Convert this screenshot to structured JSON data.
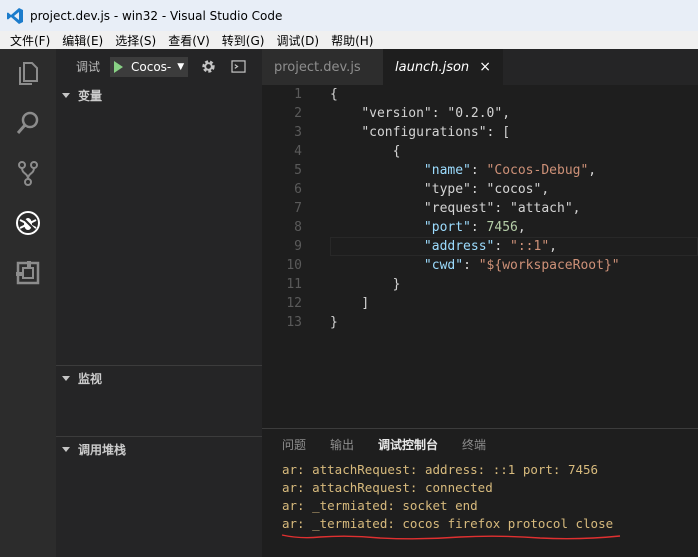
{
  "window": {
    "title": "project.dev.js - win32 - Visual Studio Code"
  },
  "menu": [
    "文件(F)",
    "编辑(E)",
    "选择(S)",
    "查看(V)",
    "转到(G)",
    "调试(D)",
    "帮助(H)"
  ],
  "activity_bar": {
    "items": [
      {
        "name": "explorer",
        "icon": "files-icon"
      },
      {
        "name": "search",
        "icon": "search-icon"
      },
      {
        "name": "source-control",
        "icon": "git-branch-icon"
      },
      {
        "name": "debug",
        "icon": "debug-bug-icon",
        "active": true
      },
      {
        "name": "extensions",
        "icon": "extensions-icon"
      }
    ]
  },
  "debug_toolbar": {
    "label": "调试",
    "configuration": "Cocos-",
    "settings_icon": "gear-icon",
    "console_icon": "terminal-icon"
  },
  "sidebar": {
    "sections": [
      {
        "title": "变量"
      },
      {
        "title": "监视"
      },
      {
        "title": "调用堆栈"
      }
    ]
  },
  "tabs": [
    {
      "label": "project.dev.js",
      "active": false
    },
    {
      "label": "launch.json",
      "active": true,
      "close": "×"
    }
  ],
  "code": {
    "line_numbers": [
      "1",
      "2",
      "3",
      "4",
      "5",
      "6",
      "7",
      "8",
      "9",
      "10",
      "11",
      "12",
      "13"
    ],
    "current_line": 9
  },
  "panel": {
    "tabs": [
      {
        "label": "问题",
        "active": false
      },
      {
        "label": "输出",
        "active": false
      },
      {
        "label": "调试控制台",
        "active": true
      },
      {
        "label": "终端",
        "active": false
      }
    ],
    "console_lines": [
      "ar: attachRequest: address: ::1 port: 7456",
      "ar: attachRequest: connected",
      "ar: _termiated: socket end",
      "ar: _termiated: cocos firefox protocol close"
    ]
  },
  "colors": {
    "accent_blue": "#007acc",
    "play_green": "#89d185",
    "annotation_red": "#e03030"
  }
}
